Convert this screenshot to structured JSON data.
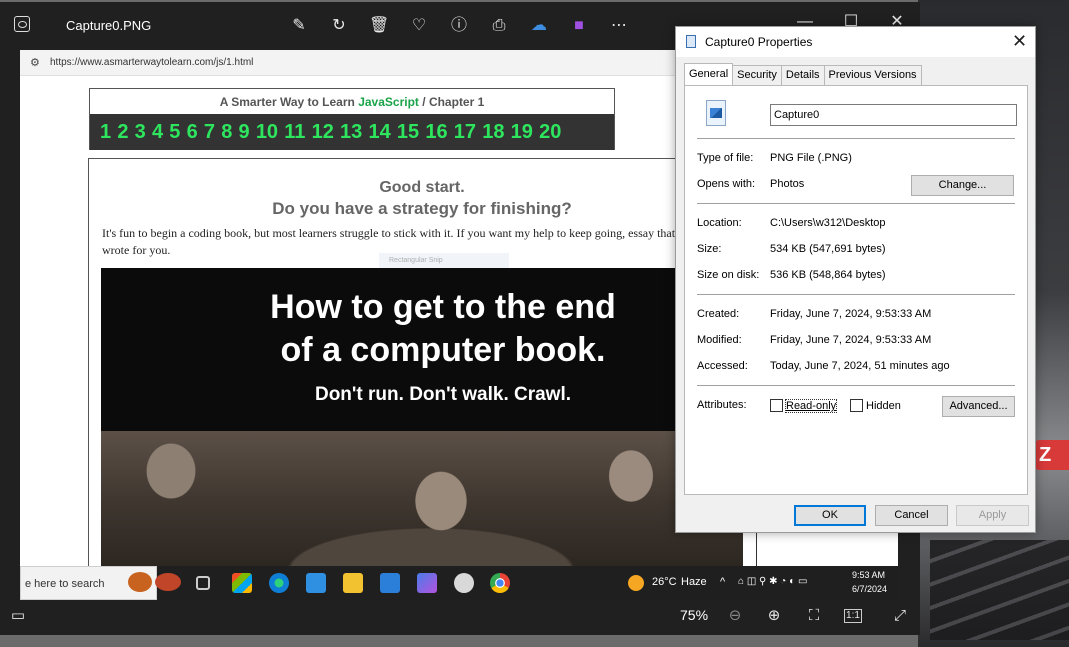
{
  "photos": {
    "title": "Capture0.PNG",
    "zoom": "75%",
    "toolbar_icons": [
      "edit-icon",
      "rotate-icon",
      "delete-icon",
      "heart-icon",
      "info-icon",
      "print-icon",
      "onedrive-icon",
      "clipchamp-icon",
      "more-icon"
    ]
  },
  "capture": {
    "url": "https://www.asmarterwaytolearn.com/js/1.html",
    "header": {
      "prefix": "A Smarter Way to Learn",
      "js": "JavaScript",
      "slash": "/",
      "chapter": "Chapter 1"
    },
    "chapters": [
      "1",
      "2",
      "3",
      "4",
      "5",
      "6",
      "7",
      "8",
      "9",
      "10",
      "11",
      "12",
      "13",
      "14",
      "15",
      "16",
      "17",
      "18",
      "19",
      "20"
    ],
    "good_start": "Good start.",
    "strategy": "Do you have a strategy for finishing?",
    "paragraph": "It's fun to begin a coding book, but most learners struggle to stick with it. If you want my help to keep going, essay that I wrote for you.",
    "snip_ghost": "Rectangular Snip",
    "banner": {
      "line1": "How to get to the end",
      "line2": "of a computer book.",
      "line3": "Don't run. Don't walk. Crawl."
    },
    "taskbar": {
      "search": "e here to search",
      "weather": "26°C",
      "weather_desc": "Haze",
      "time": "9:53 AM",
      "date": "6/7/2024"
    }
  },
  "dialog": {
    "title": "Capture0 Properties",
    "tabs": [
      "General",
      "Security",
      "Details",
      "Previous Versions"
    ],
    "file_name": "Capture0",
    "type_label": "Type of file:",
    "type_value": "PNG File (.PNG)",
    "opens_label": "Opens with:",
    "opens_value": "Photos",
    "change_button": "Change...",
    "location_label": "Location:",
    "location_value": "C:\\Users\\w312\\Desktop",
    "size_label": "Size:",
    "size_value": "534 KB (547,691 bytes)",
    "size_disk_label": "Size on disk:",
    "size_disk_value": "536 KB (548,864 bytes)",
    "created_label": "Created:",
    "created_value": "Friday, June 7, 2024, 9:53:33 AM",
    "modified_label": "Modified:",
    "modified_value": "Friday, June 7, 2024, 9:53:33 AM",
    "accessed_label": "Accessed:",
    "accessed_value": "Today, June 7, 2024, 51 minutes ago",
    "attributes_label": "Attributes:",
    "readonly_label": "Read-only",
    "hidden_label": "Hidden",
    "advanced_button": "Advanced...",
    "ok_button": "OK",
    "cancel_button": "Cancel",
    "apply_button": "Apply",
    "readonly_checked": false,
    "hidden_checked": false
  },
  "window_controls": {
    "minimize": "—",
    "maximize": "☐",
    "close": "✕"
  },
  "colors": {
    "accent": "#0078d7",
    "chapter_green": "#2ee65e",
    "js_green": "#1aa34a"
  }
}
